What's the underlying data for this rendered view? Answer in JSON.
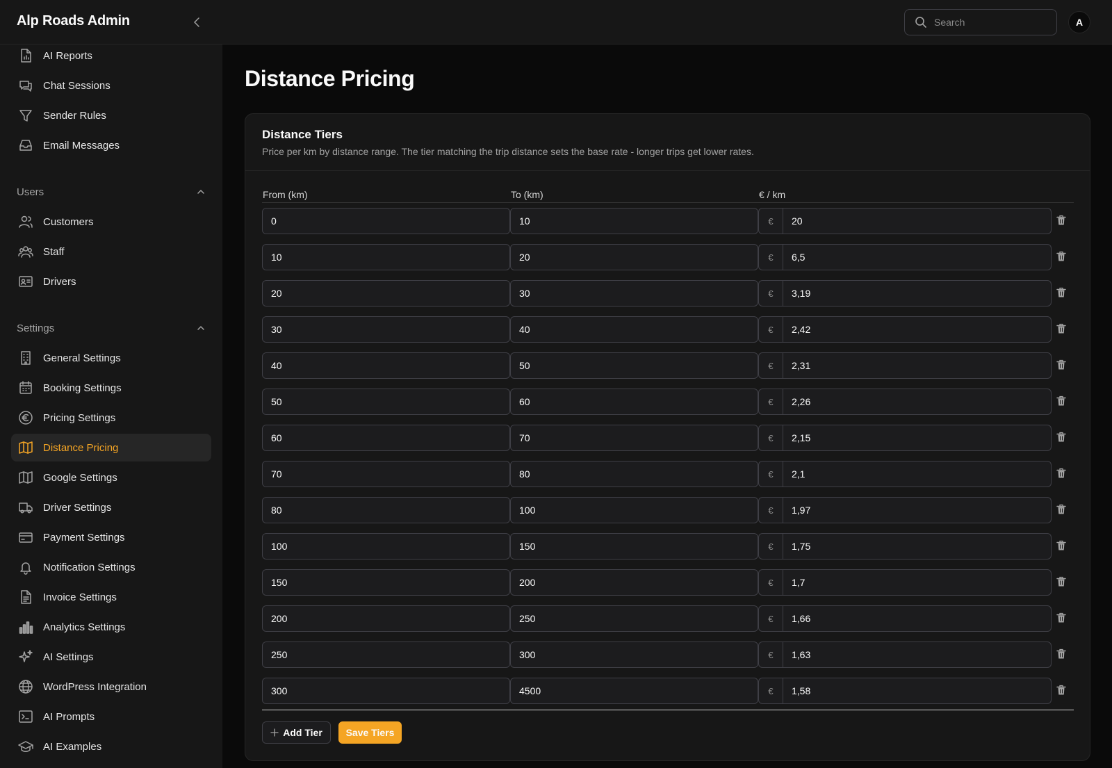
{
  "header": {
    "brand": "Alp Roads Admin",
    "search_placeholder": "Search",
    "avatar_initial": "A"
  },
  "sidebar": {
    "items_top": [
      {
        "label": "AI Reports",
        "icon": "file-chart-icon"
      },
      {
        "label": "Chat Sessions",
        "icon": "chat-icon"
      },
      {
        "label": "Sender Rules",
        "icon": "filter-icon"
      },
      {
        "label": "Email Messages",
        "icon": "inbox-icon"
      }
    ],
    "users_section": "Users",
    "users_items": [
      {
        "label": "Customers",
        "icon": "users-icon"
      },
      {
        "label": "Staff",
        "icon": "user-group-icon"
      },
      {
        "label": "Drivers",
        "icon": "id-card-icon"
      }
    ],
    "settings_section": "Settings",
    "settings_items": [
      {
        "label": "General Settings",
        "icon": "building-icon"
      },
      {
        "label": "Booking Settings",
        "icon": "calendar-icon"
      },
      {
        "label": "Pricing Settings",
        "icon": "euro-icon"
      },
      {
        "label": "Distance Pricing",
        "icon": "map-icon",
        "active": true
      },
      {
        "label": "Google Settings",
        "icon": "map-icon"
      },
      {
        "label": "Driver Settings",
        "icon": "truck-icon"
      },
      {
        "label": "Payment Settings",
        "icon": "credit-card-icon"
      },
      {
        "label": "Notification Settings",
        "icon": "bell-icon"
      },
      {
        "label": "Invoice Settings",
        "icon": "document-icon"
      },
      {
        "label": "Analytics Settings",
        "icon": "bar-chart-icon"
      },
      {
        "label": "AI Settings",
        "icon": "sparkles-icon"
      },
      {
        "label": "WordPress Integration",
        "icon": "globe-icon"
      },
      {
        "label": "AI Prompts",
        "icon": "terminal-icon"
      },
      {
        "label": "AI Examples",
        "icon": "graduation-cap-icon"
      }
    ]
  },
  "main": {
    "title": "Distance Pricing",
    "card": {
      "title": "Distance Tiers",
      "description": "Price per km by distance range. The tier matching the trip distance sets the base rate - longer trips get lower rates.",
      "columns": {
        "from": "From (km)",
        "to": "To (km)",
        "rate": "€ / km"
      },
      "currency_symbol": "€",
      "tiers": [
        {
          "from": "0",
          "to": "10",
          "rate": "20"
        },
        {
          "from": "10",
          "to": "20",
          "rate": "6,5"
        },
        {
          "from": "20",
          "to": "30",
          "rate": "3,19"
        },
        {
          "from": "30",
          "to": "40",
          "rate": "2,42"
        },
        {
          "from": "40",
          "to": "50",
          "rate": "2,31"
        },
        {
          "from": "50",
          "to": "60",
          "rate": "2,26"
        },
        {
          "from": "60",
          "to": "70",
          "rate": "2,15"
        },
        {
          "from": "70",
          "to": "80",
          "rate": "2,1"
        },
        {
          "from": "80",
          "to": "100",
          "rate": "1,97"
        },
        {
          "from": "100",
          "to": "150",
          "rate": "1,75"
        },
        {
          "from": "150",
          "to": "200",
          "rate": "1,7"
        },
        {
          "from": "200",
          "to": "250",
          "rate": "1,66"
        },
        {
          "from": "250",
          "to": "300",
          "rate": "1,63"
        },
        {
          "from": "300",
          "to": "4500",
          "rate": "1,58"
        }
      ],
      "add_label": "Add Tier",
      "save_label": "Save Tiers"
    }
  },
  "colors": {
    "accent": "#f5a524",
    "background": "#0a0a0a",
    "panel": "#171717"
  }
}
